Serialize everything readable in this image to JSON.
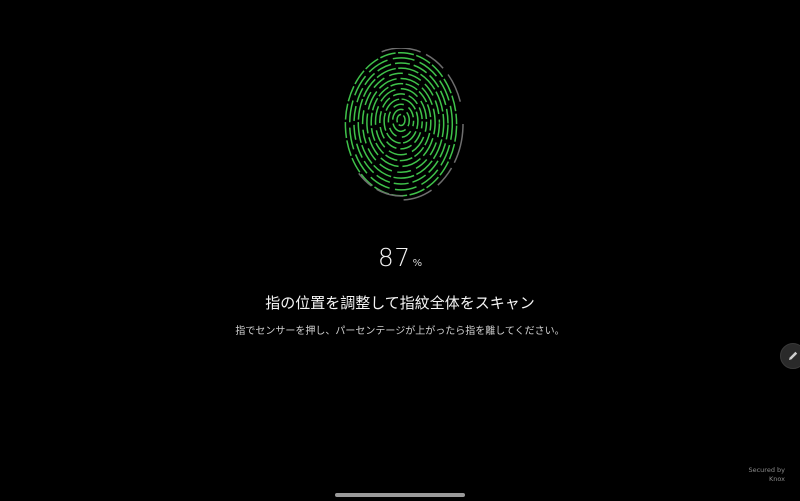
{
  "scan": {
    "progress_value": "87",
    "progress_unit": "%",
    "progress_fraction": 0.87,
    "title": "指の位置を調整して指紋全体をスキャン",
    "instruction": "指でセンサーを押し、パーセンテージが上がったら指を離してください。"
  },
  "footer": {
    "secured_line1": "Secured by",
    "secured_line2": "Knox"
  },
  "icons": {
    "fingerprint": "fingerprint-icon",
    "edit": "pencil-icon"
  },
  "colors": {
    "background": "#000000",
    "fingerprint_active": "#3fc24a",
    "fingerprint_inactive": "#6e6e6e",
    "text": "#ffffff"
  }
}
